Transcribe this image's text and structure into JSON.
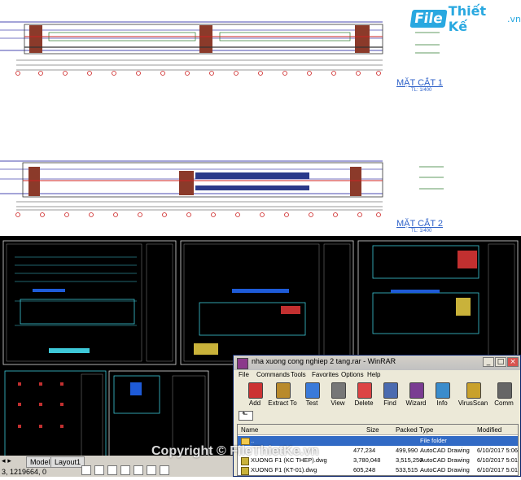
{
  "logo": {
    "part1": "File",
    "part2": "Thiết Kế",
    "part3": ".vn"
  },
  "sections": [
    {
      "title": "MẶT CẮT 1",
      "scale": "TL: 1/400"
    },
    {
      "title": "MẶT CẮT 2",
      "scale": "TL: 1/400"
    }
  ],
  "cad": {
    "tabs": [
      "Model",
      "Layout1"
    ],
    "coordinates": "3, 1219664, 0"
  },
  "winrar": {
    "title": "nha xuong cong nghiep 2 tang.rar - WinRAR",
    "menu": [
      "File",
      "Commands",
      "Tools",
      "Favorites",
      "Options",
      "Help"
    ],
    "toolbar": [
      {
        "label": "Add",
        "icon": "add-icon",
        "color": "#c33"
      },
      {
        "label": "Extract To",
        "icon": "extract-icon",
        "color": "#b98a2b"
      },
      {
        "label": "Test",
        "icon": "test-icon",
        "color": "#3a7ad9"
      },
      {
        "label": "View",
        "icon": "view-icon",
        "color": "#777"
      },
      {
        "label": "Delete",
        "icon": "delete-icon",
        "color": "#d44"
      },
      {
        "label": "Find",
        "icon": "find-icon",
        "color": "#4b6bb0"
      },
      {
        "label": "Wizard",
        "icon": "wizard-icon",
        "color": "#7a3c92"
      },
      {
        "label": "Info",
        "icon": "info-icon",
        "color": "#3a8ccc"
      },
      {
        "label": "VirusScan",
        "icon": "virusscan-icon",
        "color": "#c9a12b"
      },
      {
        "label": "Comm",
        "icon": "comment-icon",
        "color": "#666"
      }
    ],
    "columns": [
      "Name",
      "Size",
      "Packed",
      "Type",
      "Modified"
    ],
    "files": [
      {
        "name": "..",
        "size": "",
        "packed": "",
        "type": "File folder",
        "modified": ""
      },
      {
        "name": "XUONG F1 (KC THEP).dwg",
        "size": "3,780,048",
        "packed": "3,515,250",
        "type": "AutoCAD Drawing",
        "modified": "6/10/2017 5:01"
      },
      {
        "name": "XUONG F1 (KT-01).dwg",
        "size": "605,248",
        "packed": "533,515",
        "type": "AutoCAD Drawing",
        "modified": "6/10/2017 5:01"
      }
    ],
    "partial_row": {
      "size": "477,234",
      "packed": "499,990",
      "type": "AutoCAD Drawing",
      "modified": "6/10/2017 5:06"
    }
  },
  "watermark": "Copyright © FileThietKe.vn"
}
